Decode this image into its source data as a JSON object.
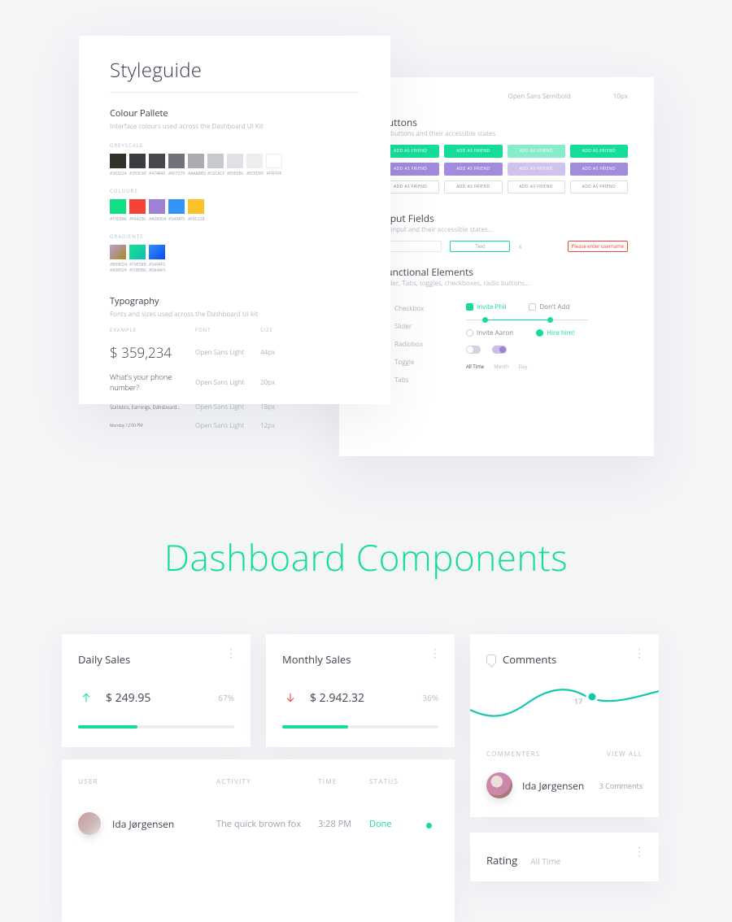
{
  "styleguide_left": {
    "title": "Styleguide",
    "colour_pallete": {
      "title": "Colour Pallete",
      "subtitle": "Interface colours used across the Dashboard UI Kit",
      "grayscale_label": "GREYSCALE",
      "grayscale": [
        {
          "hex": "#30322A"
        },
        {
          "hex": "#393C40"
        },
        {
          "hex": "#47484F"
        },
        {
          "hex": "#6F7379"
        },
        {
          "hex": "#AAABB3"
        },
        {
          "hex": "#C6CACF"
        },
        {
          "hex": "#E0E0E6"
        },
        {
          "hex": "#ECEDEF"
        },
        {
          "hex": "#FFFFFF"
        }
      ],
      "colours_label": "COLOURS",
      "colours": [
        {
          "hex": "#10DF86"
        },
        {
          "hex": "#F44236"
        },
        {
          "hex": "#A080D4"
        },
        {
          "hex": "#3494F5"
        },
        {
          "hex": "#F9C228"
        }
      ],
      "gradients_label": "GRADIENTS",
      "gradients": [
        {
          "from": "#B99FD4",
          "to": "#A58924"
        },
        {
          "from": "#18E58B",
          "to": "#10B9B6"
        },
        {
          "from": "#3494F5",
          "to": "#0A4AF5"
        }
      ]
    },
    "typography": {
      "title": "Typography",
      "subtitle": "Fonts and sizes used across the Dashboard UI kit",
      "columns": [
        "EXAMPLE",
        "FONT",
        "SIZE"
      ],
      "rows": [
        {
          "example": "$ 359,234",
          "example_size": "17px",
          "font": "Open Sans Light",
          "size": "44px"
        },
        {
          "example": "What's your phone number?",
          "example_size": "9px",
          "font": "Open Sans Light",
          "size": "20px"
        },
        {
          "example": "Statistics, Earnings, Dahsboard...",
          "example_size": "6px",
          "font": "Open Sans Light",
          "size": "18px"
        },
        {
          "example": "Monday 12:00 PM",
          "example_size": "5px",
          "font": "Open Sans Light",
          "size": "12px"
        }
      ]
    }
  },
  "styleguide_right": {
    "header_meta": {
      "font": "Open Sans Semibold",
      "size": "10px"
    },
    "buttons": {
      "title": "Buttons",
      "subtitle": "All buttons and their accessible states",
      "label": "ADD AS FRIEND",
      "row1_colors": [
        "#15dd97",
        "#15dd97",
        "#86eccb",
        "#15dd97"
      ],
      "row2_colors": [
        "#a08bdc",
        "#a08bdc",
        "#cfc3ee",
        "#a08bdc"
      ]
    },
    "fields": {
      "title": "Input Fields",
      "subtitle": "All input and their accessible states…",
      "placeholder": "Text",
      "x": "x",
      "error_text": "Please enter username"
    },
    "functional": {
      "title": "Functional Elements",
      "subtitle": "Slider, Tabs, toggles, checkboxes, radio buttons…",
      "labels": [
        "Checkbox",
        "Slider",
        "Radiobox",
        "Toggle",
        "Tabs"
      ],
      "check_on": "Invite Phil",
      "check_off": "Don't Add",
      "radio_on": "Invite Aaron",
      "radio_off": "Hire him!",
      "tabs": [
        "All Time",
        "Month",
        "Day"
      ]
    }
  },
  "hero_heading": "Dashboard Components",
  "daily_sales": {
    "title": "Daily Sales",
    "value": "$ 249.95",
    "pct": "67%",
    "progress": 38,
    "direction": "up"
  },
  "monthly_sales": {
    "title": "Monthly Sales",
    "value": "$ 2.942.32",
    "pct": "36%",
    "progress": 42,
    "direction": "down"
  },
  "comments": {
    "title": "Comments",
    "peak_value": "17",
    "commenters_label": "COMMENTERS",
    "view_all": "VIEW ALL",
    "user": "Ida Jørgensen",
    "count": "3 Comments"
  },
  "activity_table": {
    "columns": [
      "USER",
      "ACTIVITY",
      "TIME",
      "STATUS"
    ],
    "rows": [
      {
        "user": "Ida Jørgensen",
        "activity": "The quick brown fox",
        "time": "3:28 PM",
        "status": "Done"
      }
    ]
  },
  "rating": {
    "title": "Rating",
    "filter": "All Time"
  },
  "colors": {
    "teal": "#15dd97",
    "red": "#f44336",
    "purple": "#a080d4"
  }
}
